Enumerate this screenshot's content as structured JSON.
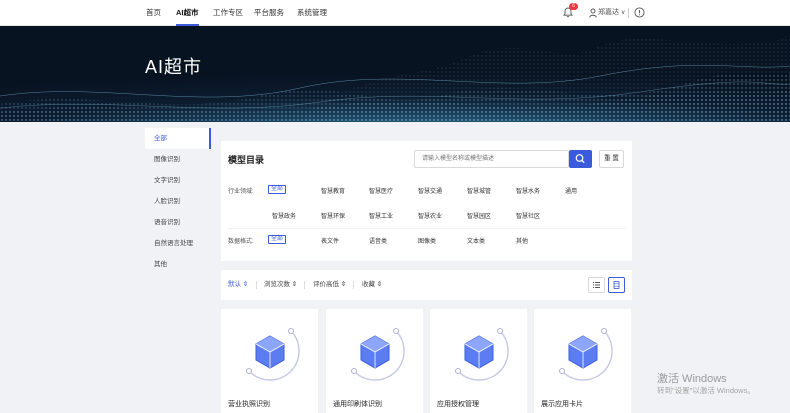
{
  "topnav": {
    "items": [
      {
        "label": "首页",
        "active": false
      },
      {
        "label": "AI超市",
        "active": true
      },
      {
        "label": "工作专区",
        "active": false
      },
      {
        "label": "平台服务",
        "active": false
      },
      {
        "label": "系统管理",
        "active": false
      }
    ],
    "notification_count": "6",
    "user_name": "郑嘉达",
    "user_caret": "∨"
  },
  "banner": {
    "title": "AI超市"
  },
  "sidebar": {
    "items": [
      {
        "label": "全部",
        "active": true
      },
      {
        "label": "图像识别"
      },
      {
        "label": "文字识别"
      },
      {
        "label": "人脸识别"
      },
      {
        "label": "语音识别"
      },
      {
        "label": "自然语言处理"
      },
      {
        "label": "其他"
      }
    ]
  },
  "catalog": {
    "title": "模型目录",
    "search_placeholder": "请输入模型名称或模型描述",
    "reset_label": "重 置",
    "industry_label": "行业领域:",
    "industry_tags": [
      "全部",
      "智慧教育",
      "智慧医疗",
      "智慧交通",
      "智慧城管",
      "智慧水务",
      "通用",
      "智慧政务",
      "智慧环保",
      "智慧工业",
      "智慧农业",
      "智慧园区",
      "智慧社区"
    ],
    "format_label": "数据格式:",
    "format_tags": [
      "全部",
      "表文件",
      "语音类",
      "图像类",
      "文本类",
      "其他"
    ]
  },
  "sortbar": {
    "items": [
      {
        "label": "默认 ⇕",
        "active": true
      },
      {
        "label": "浏览次数 ⇕"
      },
      {
        "label": "评价高低 ⇕"
      },
      {
        "label": "收藏 ⇕"
      }
    ]
  },
  "cards": [
    {
      "name": "营业执照识别"
    },
    {
      "name": "通用印刷体识别"
    },
    {
      "name": "应用授权管理"
    },
    {
      "name": "展示应用卡片"
    }
  ],
  "watermark": {
    "title": "激活 Windows",
    "subtitle": "转到\"设置\"以激活 Windows。"
  },
  "colors": {
    "accent": "#3b5bdb",
    "badge": "#f5333f",
    "banner_dark": "#0c1d30"
  }
}
